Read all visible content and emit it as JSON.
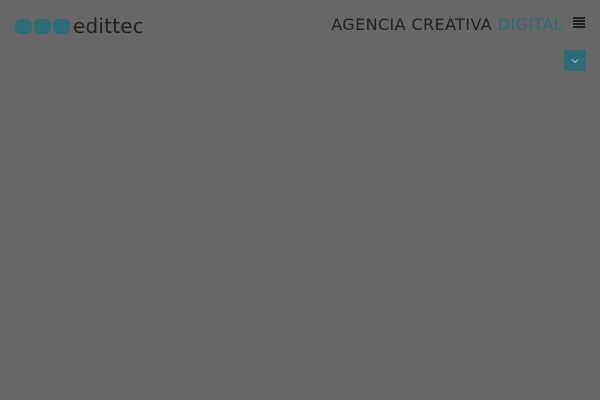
{
  "brand": {
    "name": "edittec",
    "dot_color": "#2a6d76"
  },
  "header": {
    "tagline_main": "AGENCIA CREATIVA ",
    "tagline_accent": "DIGITAL",
    "menu_icon": "hamburger-menu-icon"
  },
  "colors": {
    "overlay_bg": "#666666",
    "accent": "#2a6d76",
    "text": "#242424"
  },
  "scroll_button": {
    "icon": "chevron-down-icon"
  }
}
